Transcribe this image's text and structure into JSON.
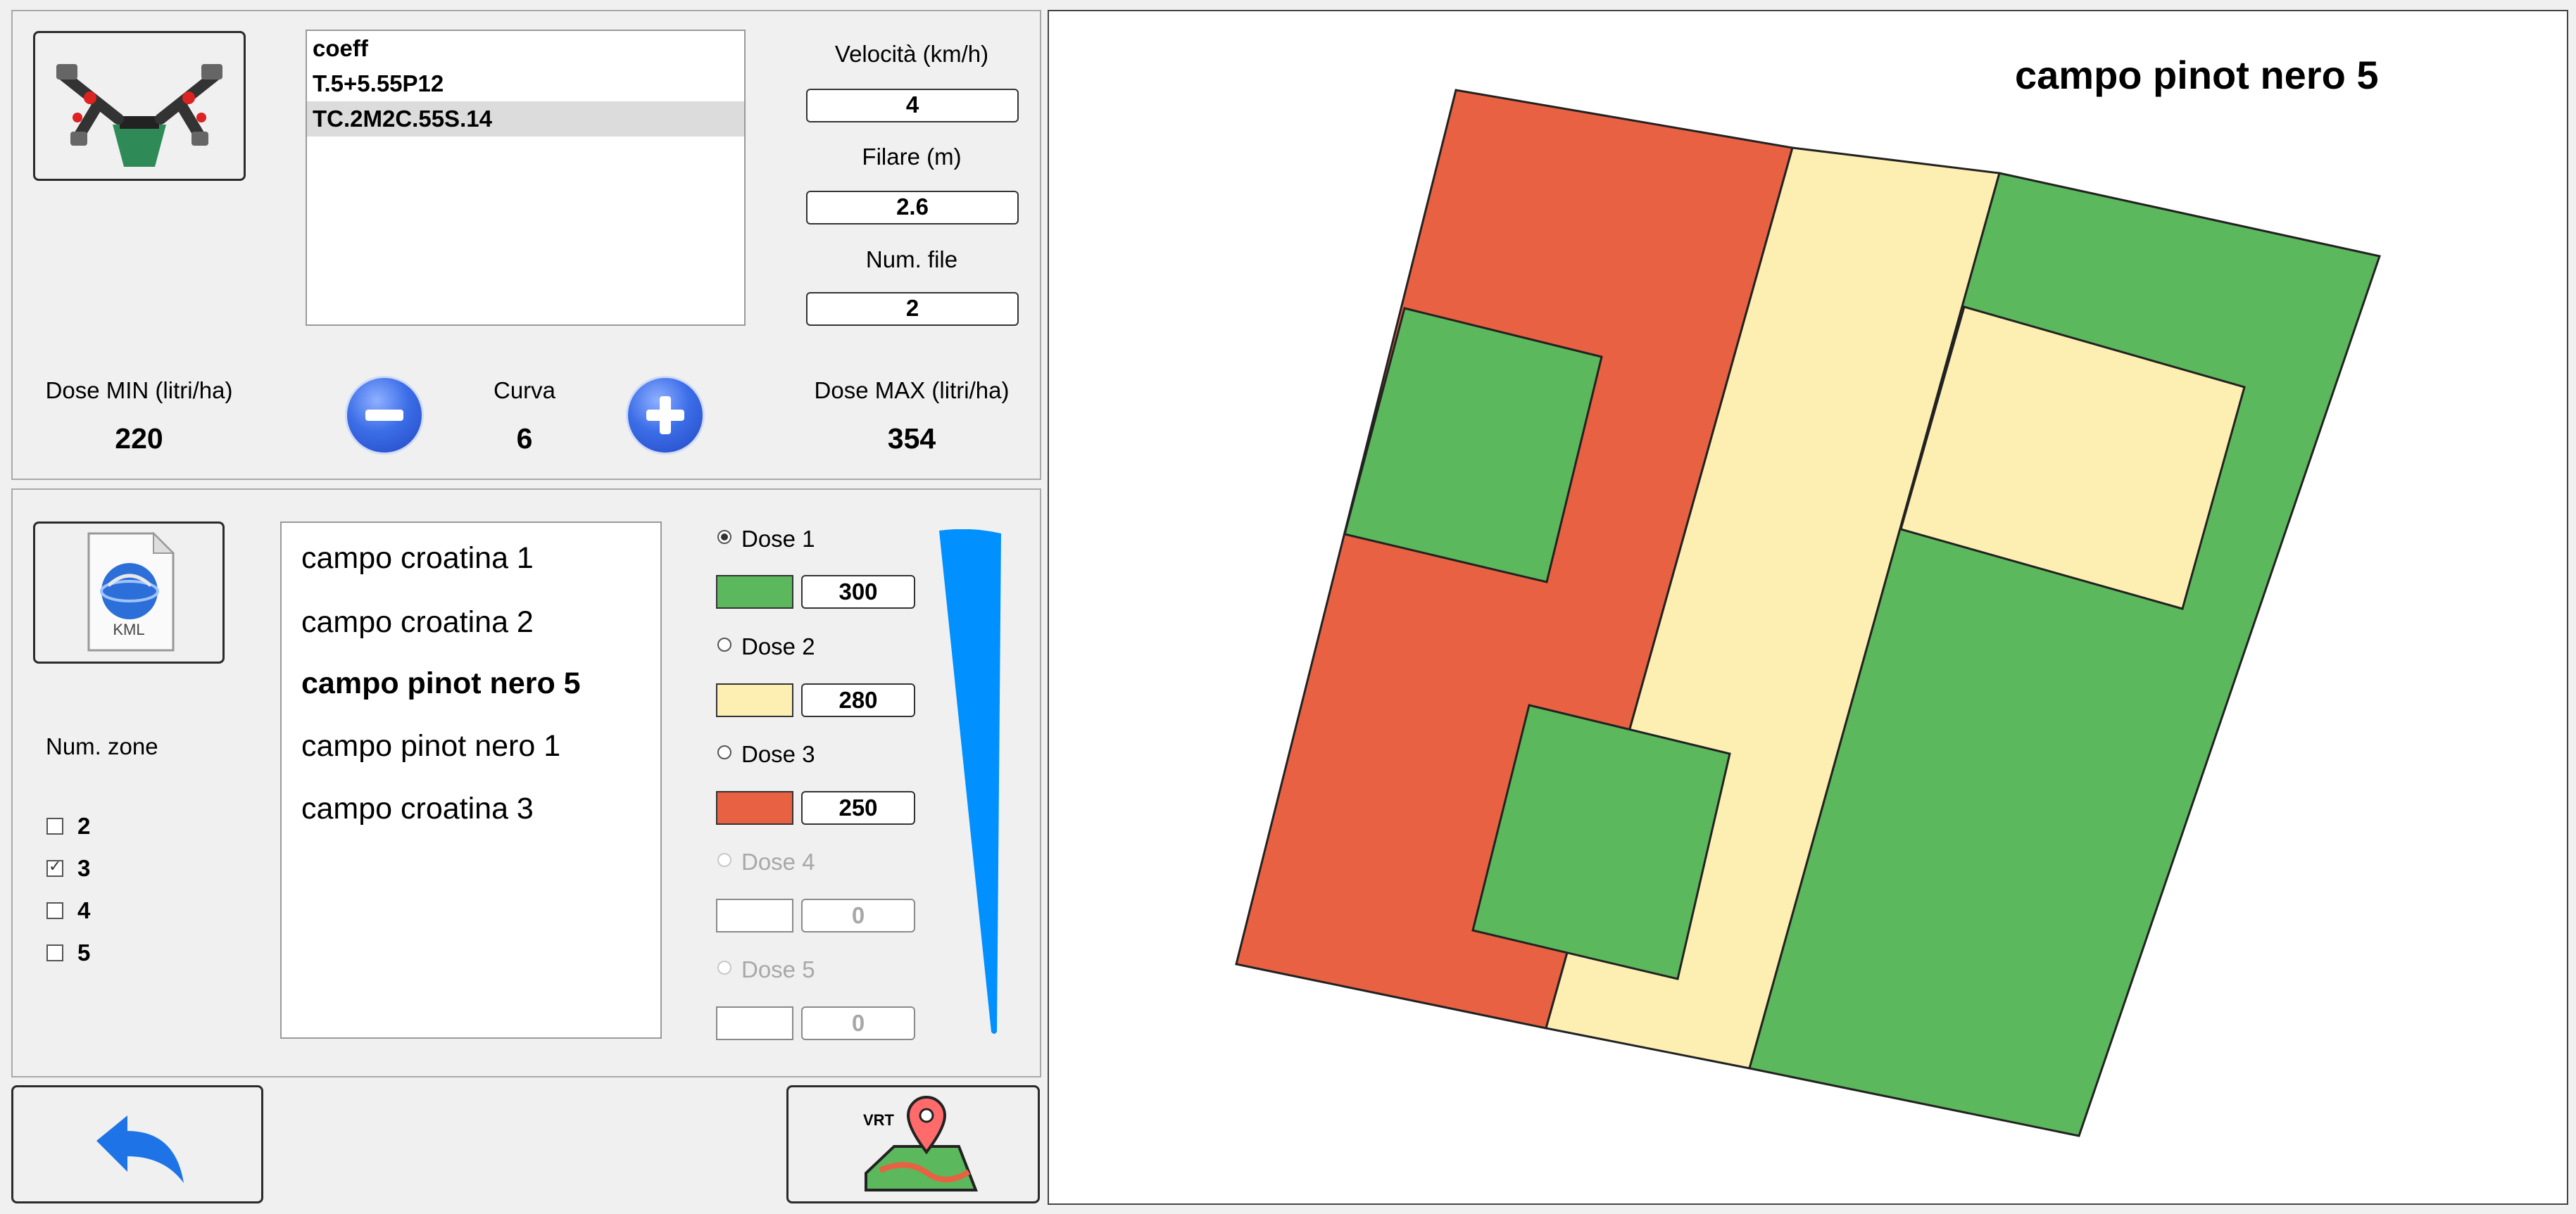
{
  "settings": {
    "coeff_header": "coeff",
    "coeff_items": [
      "T.5+5.55P12",
      "TC.2M2C.55S.14"
    ],
    "speed_label": "Velocità (km/h)",
    "speed_value": "4",
    "row_label": "Filare (m)",
    "row_value": "2.6",
    "rows_count_label": "Num. file",
    "rows_count_value": "2",
    "dose_min_label": "Dose MIN (litri/ha)",
    "dose_min_value": "220",
    "curve_label": "Curva",
    "curve_value": "6",
    "dose_max_label": "Dose MAX (litri/ha)",
    "dose_max_value": "354"
  },
  "fields_panel": {
    "kml_label": "KML",
    "zones_label": "Num. zone",
    "zone_options": [
      {
        "label": "2",
        "checked": false
      },
      {
        "label": "3",
        "checked": true
      },
      {
        "label": "4",
        "checked": false
      },
      {
        "label": "5",
        "checked": false
      }
    ],
    "fields": [
      "campo croatina 1",
      "campo croatina 2",
      "campo pinot nero 5",
      "campo pinot nero 1",
      "campo croatina 3"
    ],
    "active_field": "campo pinot nero 5",
    "doses": [
      {
        "label": "Dose 1",
        "value": "300",
        "color": "#5cb85c",
        "selected": true,
        "enabled": true
      },
      {
        "label": "Dose 2",
        "value": "280",
        "color": "#fdefb2",
        "selected": false,
        "enabled": true
      },
      {
        "label": "Dose 3",
        "value": "250",
        "color": "#e86142",
        "selected": false,
        "enabled": true
      },
      {
        "label": "Dose 4",
        "value": "0",
        "color": "#ffffff",
        "selected": false,
        "enabled": false
      },
      {
        "label": "Dose 5",
        "value": "0",
        "color": "#ffffff",
        "selected": false,
        "enabled": false
      }
    ],
    "gradient_color": "#0090ff"
  },
  "bottom": {
    "vrt_label": "VRT"
  },
  "map": {
    "title": "campo pinot nero 5",
    "colors": {
      "red": "#e86142",
      "yellow": "#fdefb2",
      "green": "#5cb85c"
    }
  }
}
